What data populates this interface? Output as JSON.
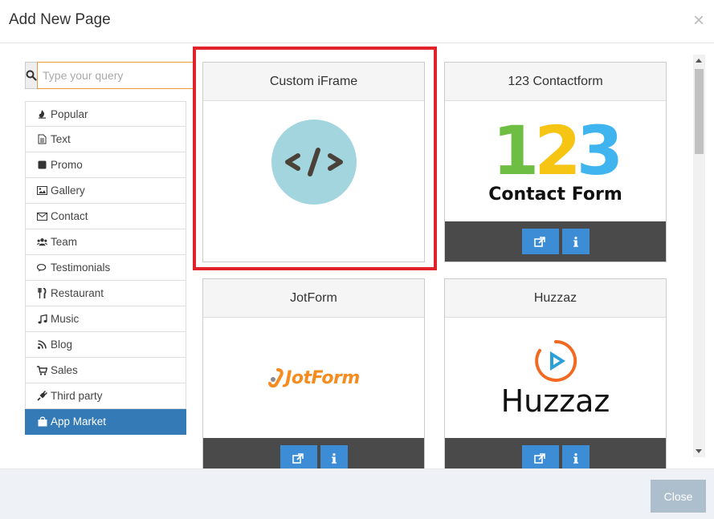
{
  "modal": {
    "title": "Add New Page",
    "close_symbol": "×"
  },
  "search": {
    "placeholder": "Type your query",
    "value": ""
  },
  "categories": [
    {
      "label": "Popular",
      "icon": "fire-icon"
    },
    {
      "label": "Text",
      "icon": "file-text-icon"
    },
    {
      "label": "Promo",
      "icon": "square-icon"
    },
    {
      "label": "Gallery",
      "icon": "image-icon"
    },
    {
      "label": "Contact",
      "icon": "envelope-icon"
    },
    {
      "label": "Team",
      "icon": "users-icon"
    },
    {
      "label": "Testimonials",
      "icon": "comments-icon"
    },
    {
      "label": "Restaurant",
      "icon": "cutlery-icon"
    },
    {
      "label": "Music",
      "icon": "music-icon"
    },
    {
      "label": "Blog",
      "icon": "rss-icon"
    },
    {
      "label": "Sales",
      "icon": "shopping-cart-icon"
    },
    {
      "label": "Third party",
      "icon": "plug-icon"
    },
    {
      "label": "App Market",
      "icon": "shopping-bag-icon",
      "active": true
    }
  ],
  "cards": [
    {
      "title": "Custom iFrame",
      "logo": "code-icon",
      "highlighted": true
    },
    {
      "title": "123 Contactform",
      "logo_digits": [
        "1",
        "2",
        "3"
      ],
      "logo_text": "Contact Form"
    },
    {
      "title": "JotForm",
      "logo_text": "JotForm"
    },
    {
      "title": "Huzzaz",
      "logo_text": "Huzzaz"
    }
  ],
  "footer": {
    "close_label": "Close"
  },
  "colors": {
    "primary": "#337ab7",
    "highlight": "#e0232a",
    "card_footer": "#4a4a4a",
    "action_button": "#3c8dd5",
    "close_button": "#adbfcc"
  }
}
